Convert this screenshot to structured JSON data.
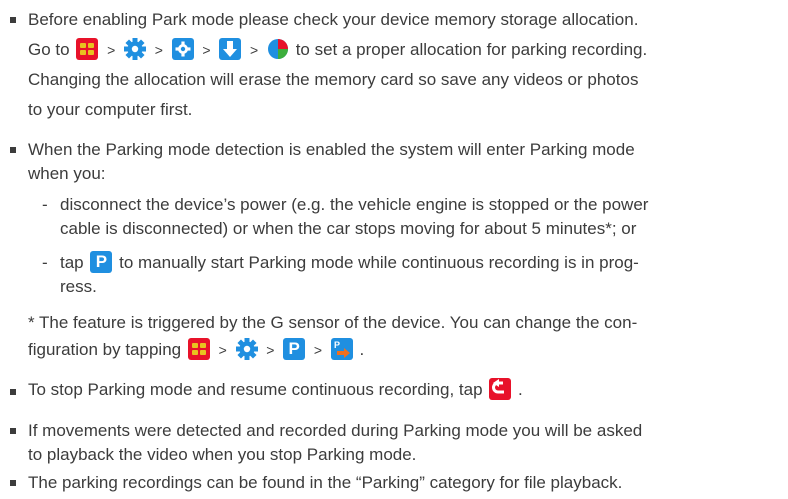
{
  "bullet1": {
    "line1": "Before enabling Park mode please check your device memory storage allocation.",
    "line2_pre": "Go to",
    "line2_post": "to set a proper allocation for parking recording.",
    "line3": "Changing the allocation will erase the memory card so save any videos or photos",
    "line4": "to your computer first."
  },
  "bullet2": {
    "line1": "When the Parking mode detection is enabled the system will enter Parking mode",
    "line2": "when you:",
    "sub1_line1": "disconnect the device’s power (e.g. the vehicle engine is stopped or the power",
    "sub1_line2": "cable is disconnected) or when the car stops moving for about 5 minutes*; or",
    "sub2_pre": "tap",
    "sub2_post": "to manually start Parking mode while continuous recording is in prog-",
    "sub2_line2": "ress.",
    "dash": "-"
  },
  "note": {
    "line1": "* The feature is triggered by the G sensor of the device. You can change the con-",
    "line2_pre": "figuration by tapping",
    "line2_post": "."
  },
  "bullet3": {
    "pre": "To stop Parking mode and resume continuous recording, tap",
    "post": "."
  },
  "bullet4": {
    "line1": "If movements were detected and recorded during Parking mode you will be asked",
    "line2": "to playback the video when you stop Parking mode."
  },
  "bullet5": {
    "line1": "The parking recordings can be found in the “Parking” category for file playback."
  },
  "separator": ">",
  "icons": {
    "menu": "menu-icon",
    "settings": "gear-icon",
    "settings_sub": "gear-tile-icon",
    "storage": "download-arrow-icon",
    "allocation": "pie-chart-icon",
    "parking": "parking-p-icon",
    "parking_settings": "parking-settings-icon",
    "back": "back-arrow-icon"
  },
  "colors": {
    "text": "#3c3c3c",
    "red": "#e8122a",
    "blue": "#1f8fe0",
    "yellow": "#e8c320",
    "green": "#3cae3c"
  }
}
